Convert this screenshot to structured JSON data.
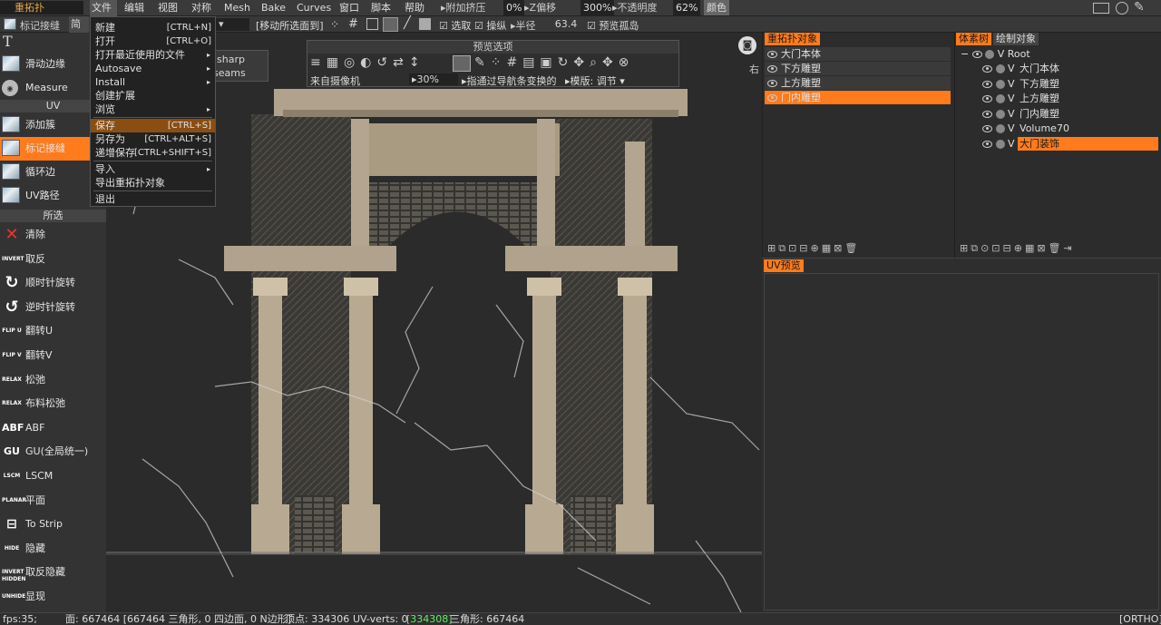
{
  "menubar": {
    "mode": "重拓扑",
    "items": [
      "文件",
      "编辑",
      "视图",
      "对称",
      "Mesh",
      "Bake",
      "Curves",
      "窗口",
      "脚本",
      "帮助"
    ],
    "additive_extrude": "附加挤压",
    "additive_value": "0%",
    "z_offset": "Z偏移",
    "z_value": "300%",
    "opacity_label": "不透明度",
    "opacity_value": "62%",
    "color_label": "颜色"
  },
  "toolbar2": {
    "mark_seams": "标记接缝",
    "simple": "简单",
    "move_target": "[移动所选面到]",
    "select_label": "选取",
    "sheet_label": "操纵",
    "radius_label": "半径",
    "radius_value": "63.4",
    "preview_island": "预览孤岛"
  },
  "file_menu": [
    {
      "label": "新建",
      "shortcut": "[CTRL+N]"
    },
    {
      "label": "打开",
      "shortcut": "[CTRL+O]"
    },
    {
      "label": "打开最近使用的文件",
      "shortcut": "",
      "arrow": "▸"
    },
    {
      "label": "Autosave",
      "shortcut": "",
      "arrow": "▸"
    },
    {
      "label": "Install",
      "shortcut": "",
      "arrow": "▸"
    },
    {
      "label": "创建扩展",
      "shortcut": ""
    },
    {
      "label": "浏览",
      "shortcut": "",
      "arrow": "▸"
    },
    {
      "label": "保存",
      "shortcut": "[CTRL+S]"
    },
    {
      "label": "另存为",
      "shortcut": "[CTRL+ALT+S]"
    },
    {
      "label": "递增保存",
      "shortcut": "[CTRL+SHIFT+S]"
    },
    {
      "label": "导入",
      "shortcut": "",
      "arrow": "▸"
    },
    {
      "label": "导出重拓扑对象",
      "shortcut": ""
    },
    {
      "label": "退出",
      "shortcut": ""
    }
  ],
  "submenu": {
    "item1": "sharp",
    "item2": "seams"
  },
  "left_panel": {
    "top_label": "T",
    "items_top": [
      {
        "label": "滑动边缘"
      },
      {
        "label": "Measure"
      }
    ],
    "uv_header": "UV",
    "items_uv": [
      {
        "label": "添加簇"
      },
      {
        "label": "标记接缝"
      },
      {
        "label": "循环边"
      },
      {
        "label": "UV路径"
      }
    ],
    "sel_header": "所选",
    "items_sel": [
      {
        "icon": "✕",
        "label": "清除"
      },
      {
        "icon": "INVERT",
        "label": "取反"
      },
      {
        "icon": "↻",
        "label": "顺时针旋转"
      },
      {
        "icon": "↺",
        "label": "逆时针旋转"
      },
      {
        "icon": "FLIP U",
        "label": "翻转U"
      },
      {
        "icon": "FLIP V",
        "label": "翻转V"
      },
      {
        "icon": "RELAX",
        "label": "松弛"
      },
      {
        "icon": "RELAX",
        "label": "布料松弛"
      },
      {
        "icon": "ABF",
        "label": "ABF"
      },
      {
        "icon": "GU",
        "label": "GU(全局统一)"
      },
      {
        "icon": "LSCM",
        "label": "LSCM"
      },
      {
        "icon": "PLANAR",
        "label": "平面"
      },
      {
        "icon": "⊟",
        "label": "To Strip"
      },
      {
        "icon": "HIDE",
        "label": "隐藏"
      },
      {
        "icon": "INVERT HIDDEN",
        "label": "取反隐藏"
      },
      {
        "icon": "UNHIDE",
        "label": "显现"
      }
    ]
  },
  "preview": {
    "title": "预览选项",
    "from_camera": "来自摄像机",
    "percent": "30%",
    "guide": "指通过导航条变换的",
    "template": "模版: 调节"
  },
  "viewport": {
    "corner_label": "右"
  },
  "retopo_panel": {
    "title": "重拓扑对象",
    "objects": [
      "大门本体",
      "下方雕塑",
      "上方雕塑",
      "门内雕塑"
    ],
    "selected_index": 3
  },
  "voxel_panel": {
    "tab_active": "体素树",
    "tab_other": "绘制对象",
    "root": "Root",
    "items": [
      "大门本体",
      "下方雕塑",
      "上方雕塑",
      "门内雕塑",
      "Volume70",
      "大门装饰"
    ],
    "selected_index": 5
  },
  "uv_preview": {
    "title": "UV预览"
  },
  "status": {
    "fps": "fps:35;",
    "faces": "面: 667464 [667464 三角形, 0 四边面, 0 N边形]",
    "verts": "顶点: 334306",
    "uv_verts_label": "UV-verts: 0",
    "uv_verts_value": "[334308]",
    "triangles": "三角形: 667464",
    "ortho": "[ORTHO]"
  },
  "colors": {
    "accent": "#ff7b1c",
    "highlight": "#8a4e13",
    "bg": "#2a2a2a"
  }
}
